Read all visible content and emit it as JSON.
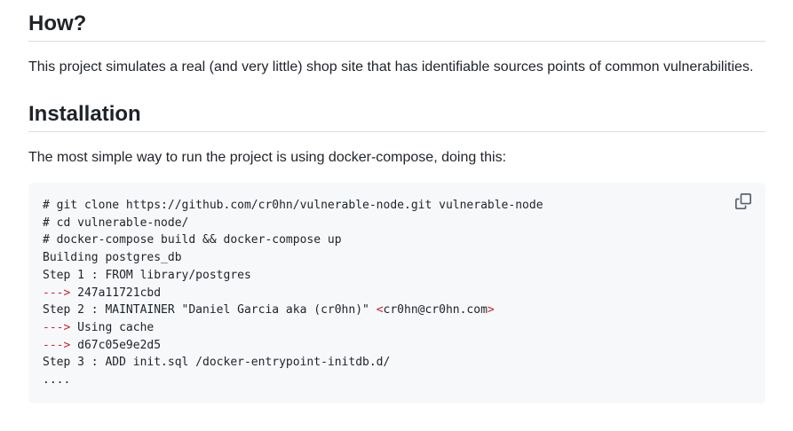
{
  "sections": {
    "how": {
      "heading": "How?",
      "text": "This project simulates a real (and very little) shop site that has identifiable sources points of common vulnerabilities."
    },
    "installation": {
      "heading": "Installation",
      "text": "The most simple way to run the project is using docker-compose, doing this:"
    }
  },
  "code": {
    "copy_icon": "copy-icon",
    "accent_color": "#cf222e",
    "lines": [
      "# git clone https://github.com/cr0hn/vulnerable-node.git vulnerable-node",
      "# cd vulnerable-node/",
      "# docker-compose build && docker-compose up",
      "Building postgres_db",
      "Step 1 : FROM library/postgres",
      {
        "red": "--->",
        "rest": " 247a11721cbd"
      },
      {
        "pre": "Step 2 : MAINTAINER \"Daniel Garcia aka (cr0hn)\" ",
        "red1": "<",
        "mid": "cr0hn@cr0hn.com",
        "red2": ">"
      },
      {
        "red": "--->",
        "rest": " Using cache"
      },
      {
        "red": "--->",
        "rest": " d67c05e9e2d5"
      },
      "Step 3 : ADD init.sql /docker-entrypoint-initdb.d/",
      "...."
    ]
  }
}
